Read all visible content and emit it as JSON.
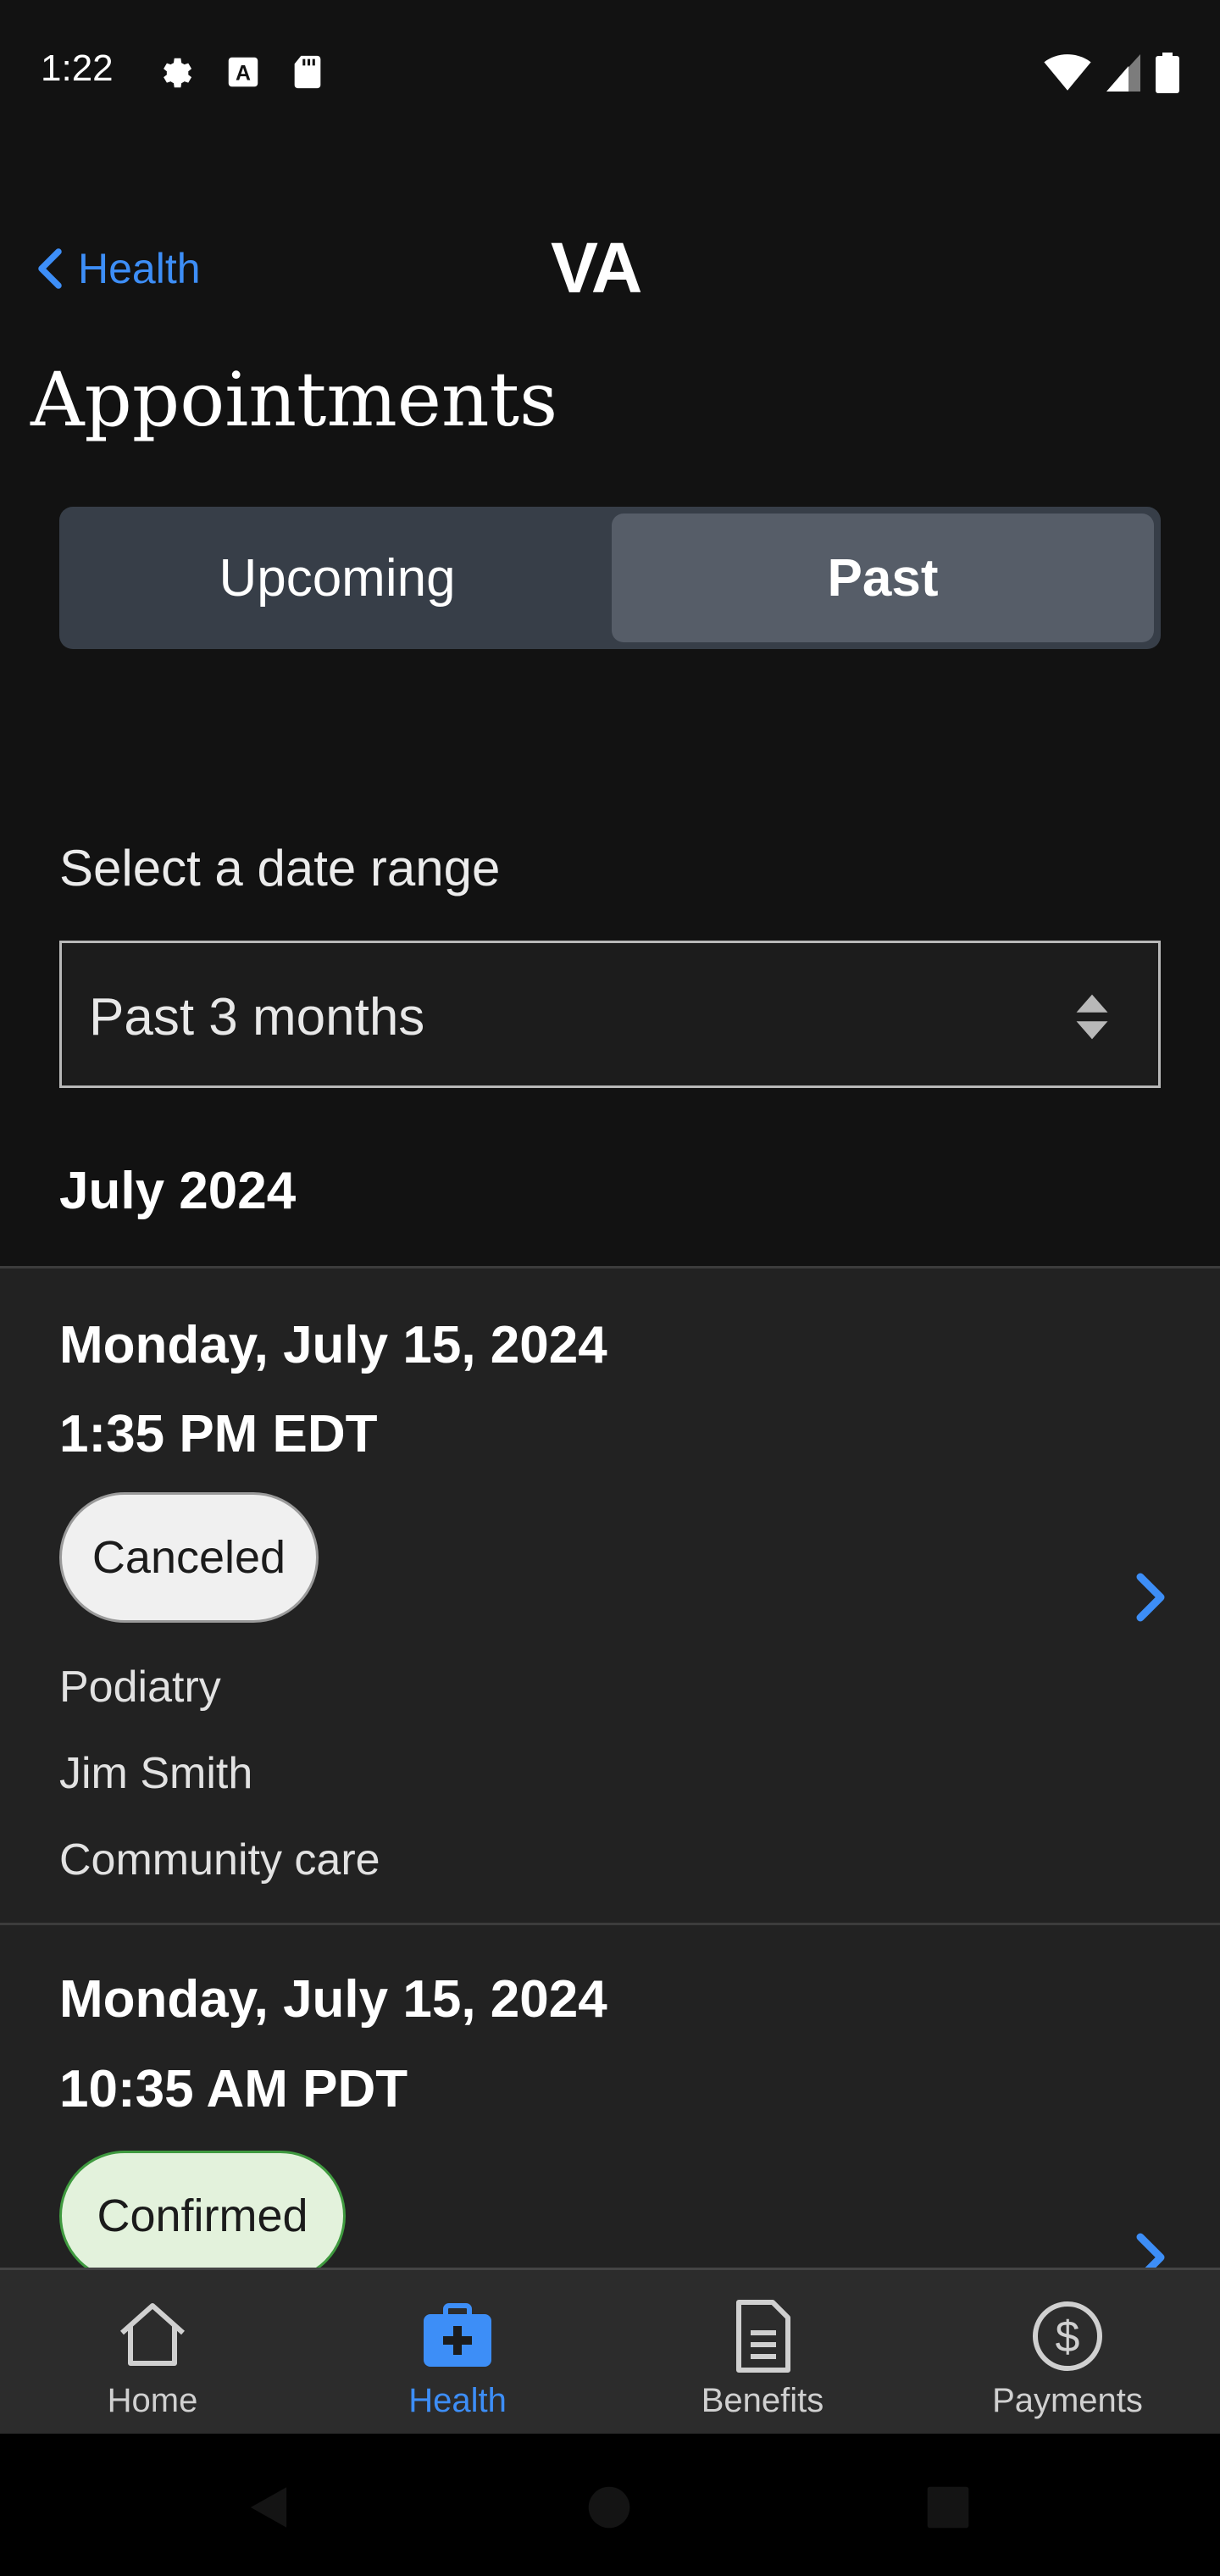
{
  "status_bar": {
    "time": "1:22",
    "left_icons": [
      "gear-icon",
      "a-box-icon",
      "sd-card-icon"
    ],
    "right_icons": [
      "wifi-icon",
      "signal-icon",
      "battery-icon"
    ]
  },
  "header": {
    "back_label": "Health",
    "logo": "VA",
    "title": "Appointments"
  },
  "tabs": [
    {
      "label": "Upcoming",
      "selected": false
    },
    {
      "label": "Past",
      "selected": true
    }
  ],
  "date_range": {
    "label": "Select a date range",
    "value": "Past 3 months"
  },
  "month_heading": "July 2024",
  "appointments": [
    {
      "date": "Monday, July 15, 2024",
      "time": "1:35 PM EDT",
      "status": "Canceled",
      "type": "Podiatry",
      "provider": "Jim Smith",
      "location": "Community care"
    },
    {
      "date": "Monday, July 15, 2024",
      "time": "10:35 AM PDT",
      "status": "Confirmed"
    }
  ],
  "bottom_nav": [
    {
      "label": "Home",
      "icon": "home-icon",
      "active": false
    },
    {
      "label": "Health",
      "icon": "medical-kit-icon",
      "active": true
    },
    {
      "label": "Benefits",
      "icon": "document-icon",
      "active": false
    },
    {
      "label": "Payments",
      "icon": "dollar-circle-icon",
      "active": false
    }
  ],
  "colors": {
    "accent": "#3d8ef7",
    "background": "#121212",
    "card": "#222222"
  }
}
